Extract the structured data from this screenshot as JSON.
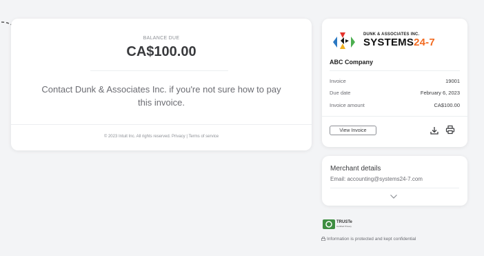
{
  "balance": {
    "label": "BALANCE DUE",
    "amount": "CA$100.00"
  },
  "contact_message": "Contact Dunk & Associates Inc. if you're not sure how to pay this invoice.",
  "footer": "© 2023 Intuit Inc. All rights reserved. Privacy | Terms of service",
  "invoice": {
    "logo_top": "DUNK & ASSOCIATES INC.",
    "logo_systems": "SYSTEMS",
    "logo_num": "24-7",
    "company": "ABC Company",
    "rows": [
      {
        "label": "Invoice",
        "value": "19001"
      },
      {
        "label": "Due date",
        "value": "February 6, 2023"
      },
      {
        "label": "Invoice amount",
        "value": "CA$100.00"
      }
    ],
    "view_button": "View Invoice"
  },
  "merchant": {
    "title": "Merchant details",
    "email": "Email: accounting@systems24-7.com"
  },
  "truste": {
    "name": "TRUSTe",
    "sub": "Certified Privacy"
  },
  "protected_note": "Information is protected and kept confidential",
  "colors": {
    "accent_orange": "#f26b21",
    "background": "#f3f4f6",
    "card": "#ffffff"
  }
}
